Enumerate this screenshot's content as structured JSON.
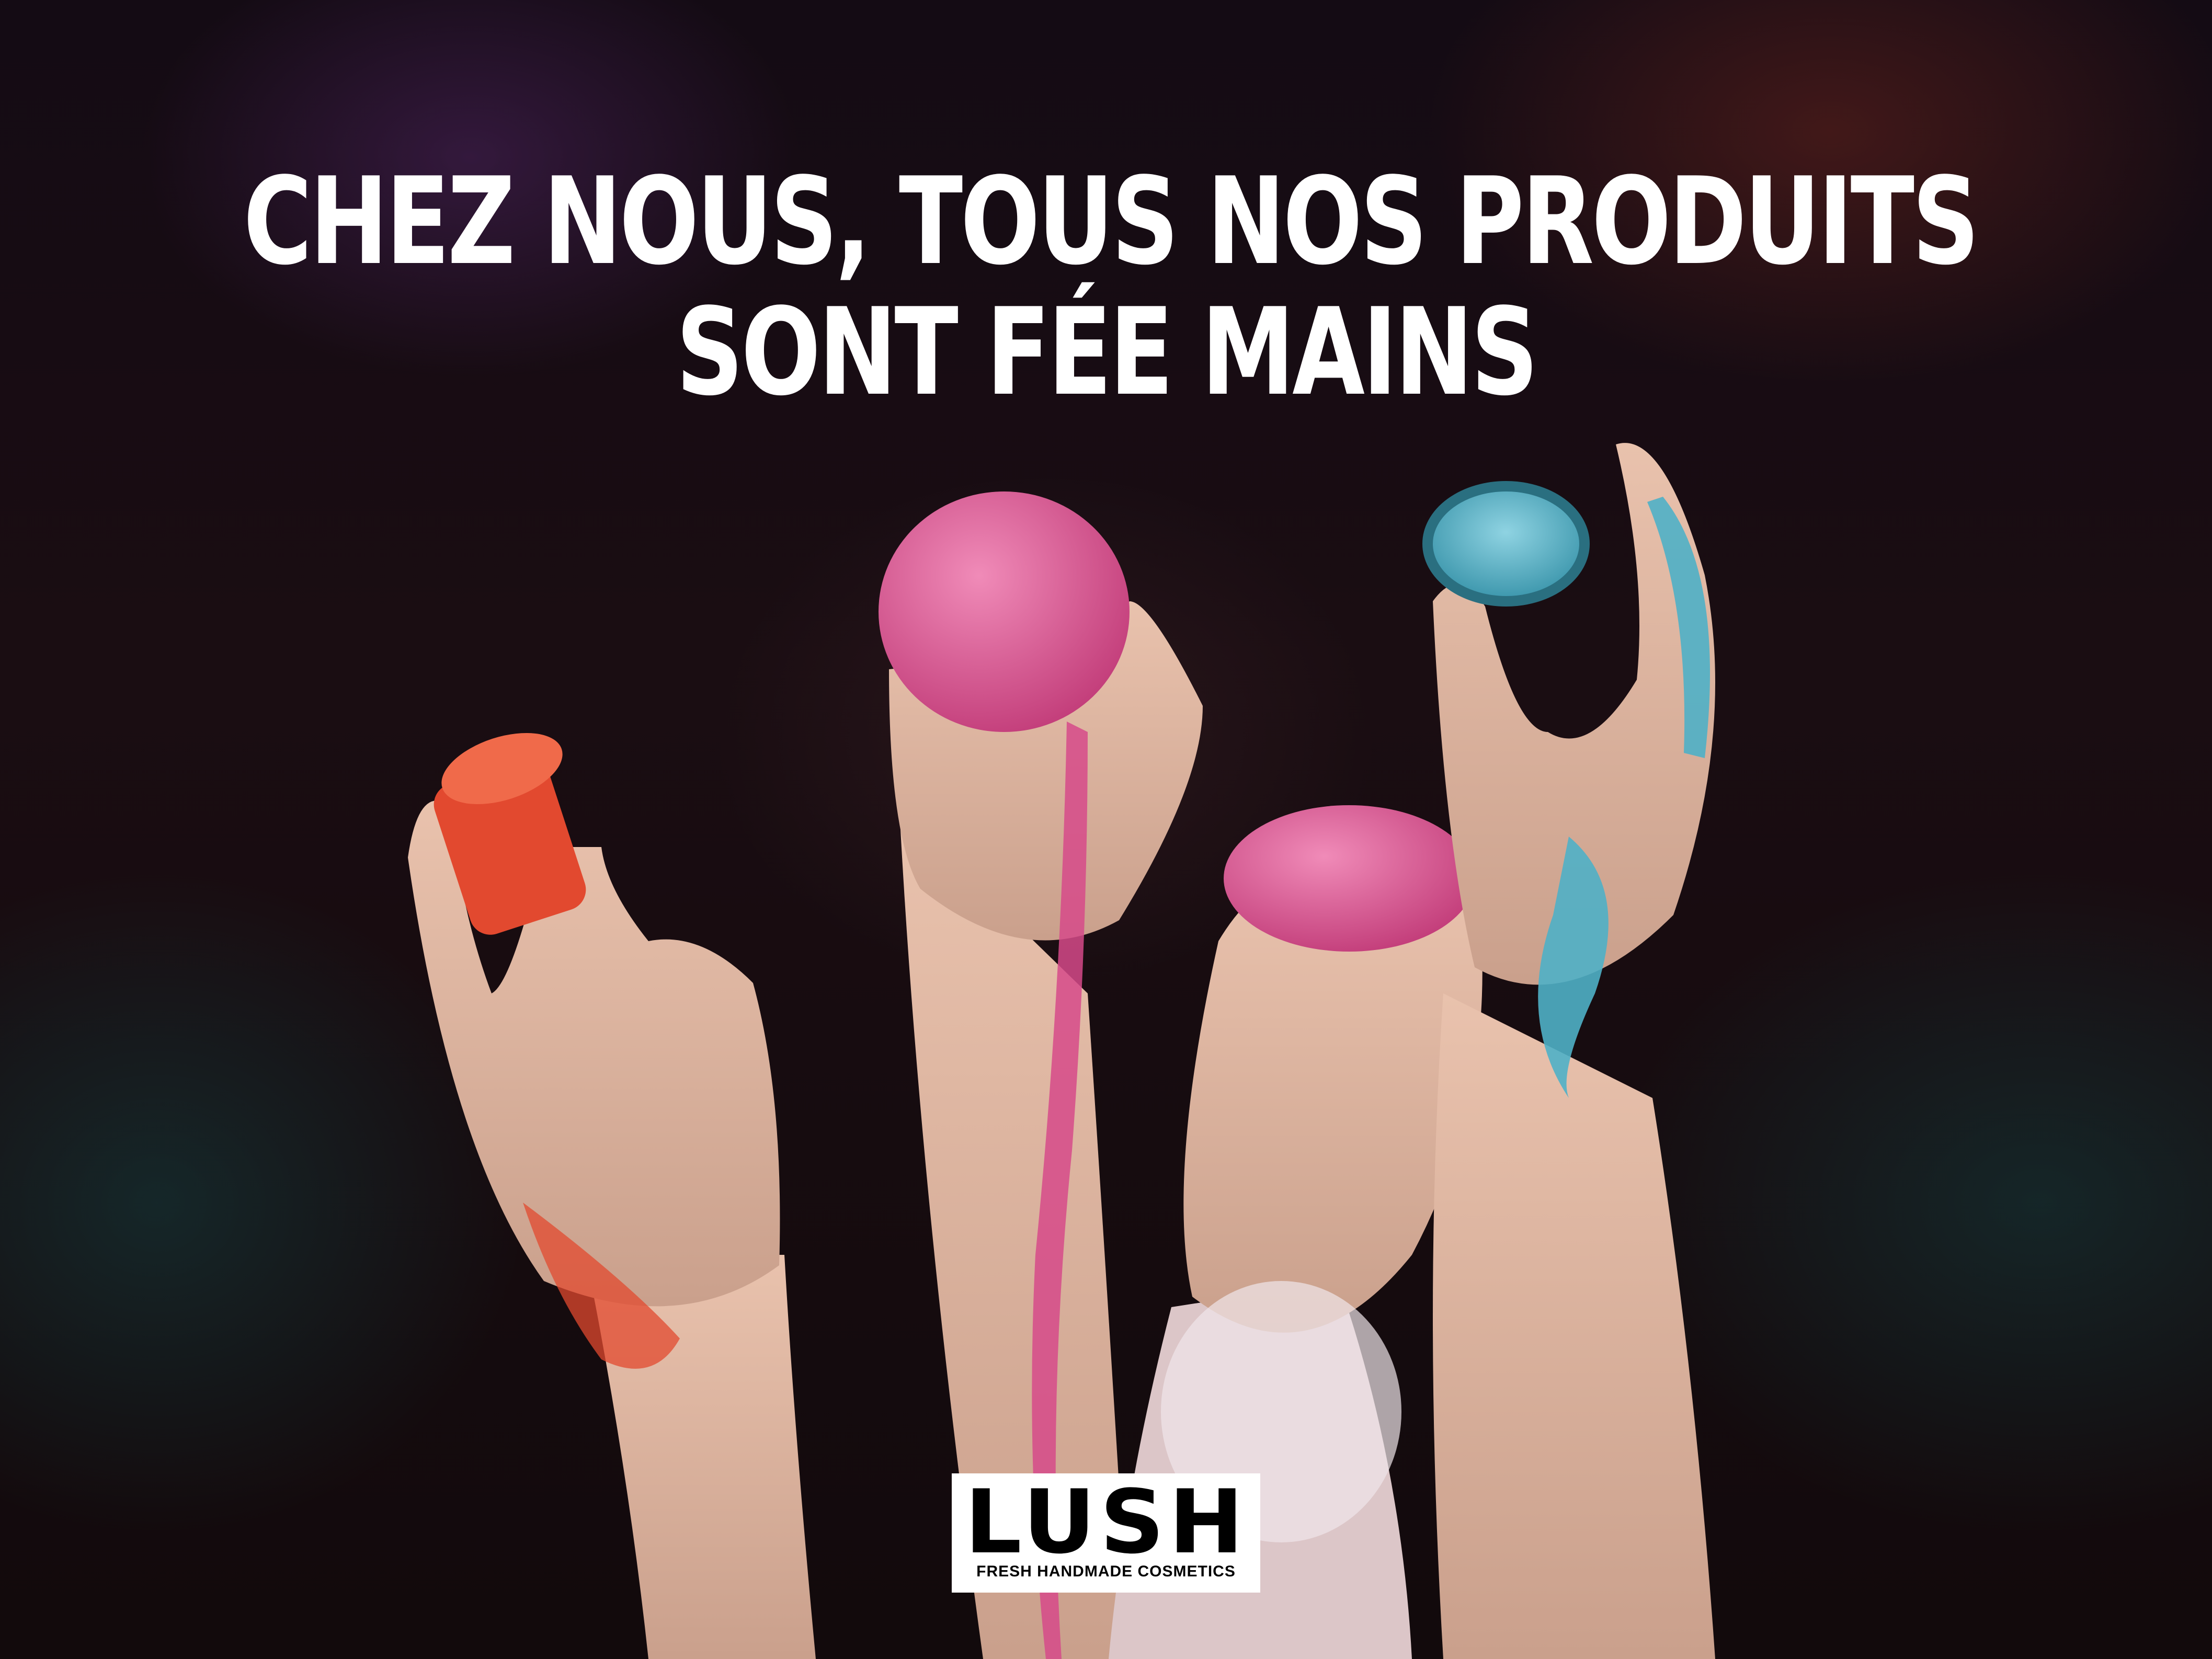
{
  "headline": {
    "line1": "CHEZ NOUS, TOUS NOS PRODUITS",
    "line2": "SONT FÉE MAINS"
  },
  "logo": {
    "wordmark": "LUSH",
    "tagline": "FRESH HANDMADE COSMETICS"
  },
  "colors": {
    "background": "#120a0c",
    "headline_text": "#ffffff",
    "logo_bg": "#ffffff",
    "logo_text": "#000000",
    "product_red": "#e2492f",
    "product_pink": "#d64a8a",
    "product_blue": "#4fb0c6"
  }
}
